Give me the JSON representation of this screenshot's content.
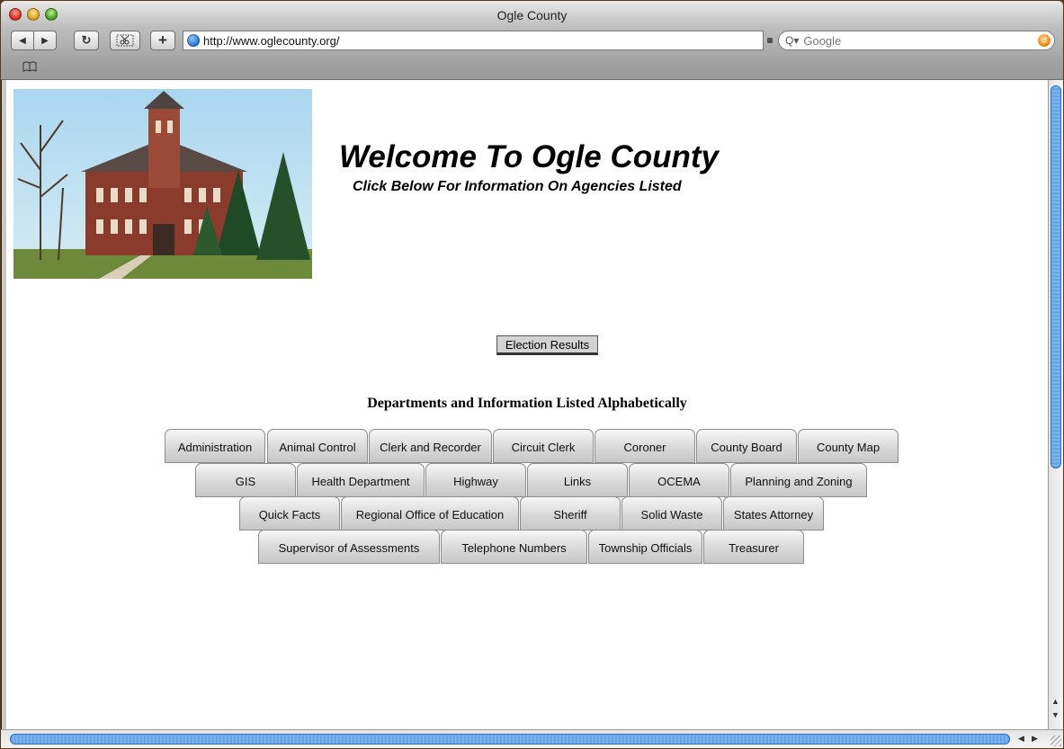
{
  "window": {
    "title": "Ogle County"
  },
  "toolbar": {
    "back_icon": "◀",
    "forward_icon": "▶",
    "reload_icon": "↻",
    "add_icon": "+",
    "address_url": "http://www.oglecounty.org/",
    "search_placeholder": "Google",
    "search_icon": "Q▾"
  },
  "bookmarks": {
    "book_icon": "📖"
  },
  "page": {
    "welcome_title": "Welcome To Ogle County",
    "subtitle": "Click Below For Information On Agencies Listed",
    "election_button": "Election Results",
    "departments_heading": "Departments and Information Listed Alphabetically"
  },
  "tabs": {
    "row1": [
      "Administration",
      "Animal Control",
      "Clerk and Recorder",
      "Circuit Clerk",
      "Coroner",
      "County Board",
      "County Map"
    ],
    "row2": [
      "GIS",
      "Health Department",
      "Highway",
      "Links",
      "OCEMA",
      "Planning and Zoning"
    ],
    "row3": [
      "Quick Facts",
      "Regional Office of Education",
      "Sheriff",
      "Solid Waste",
      "States Attorney"
    ],
    "row4": [
      "Supervisor of Assessments",
      "Telephone Numbers",
      "Township Officials",
      "Treasurer"
    ]
  },
  "colors": {
    "window_frame": "#5a3a1c",
    "scroll_thumb": "#5f9ee8",
    "tab_face": "#d6d6d6"
  }
}
